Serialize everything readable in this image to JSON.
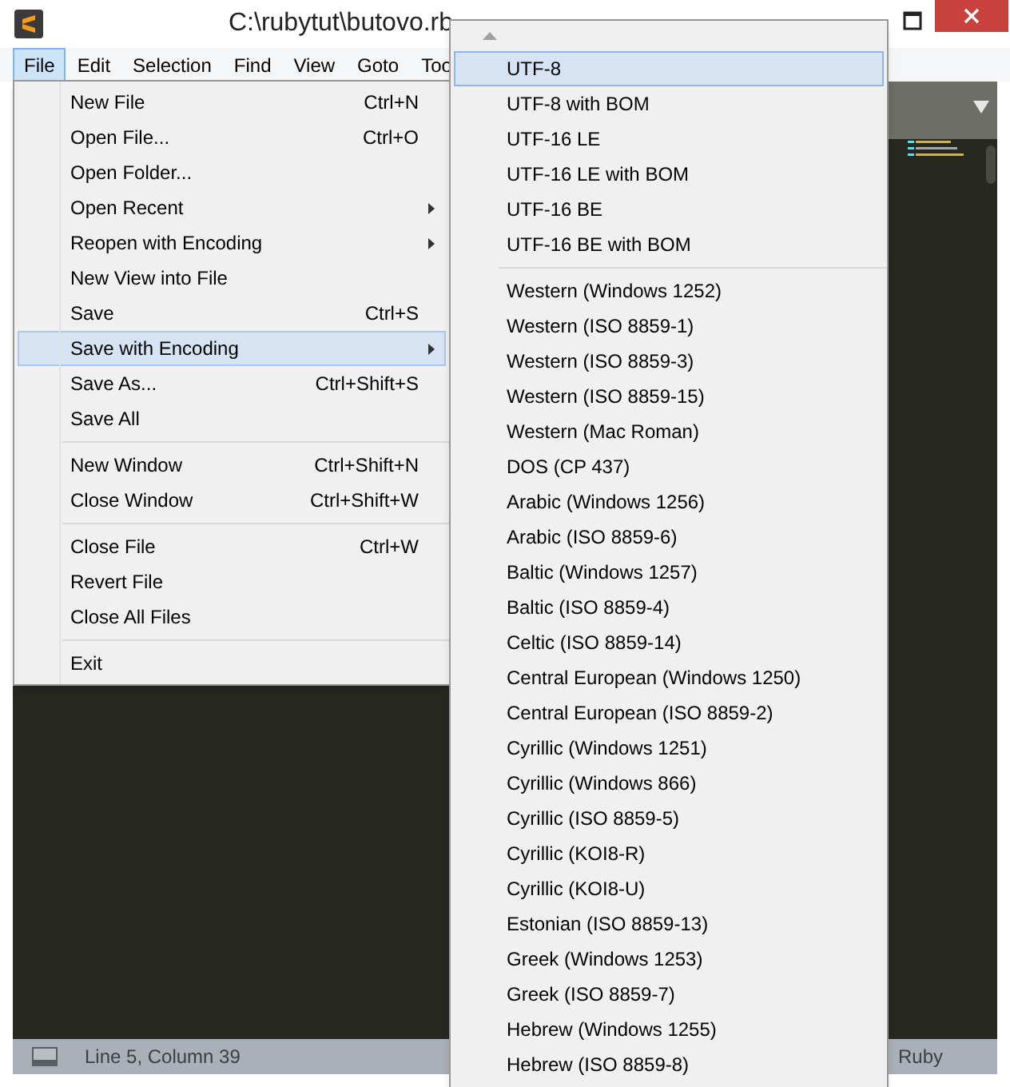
{
  "window": {
    "title": "C:\\rubytut\\butovo.rb"
  },
  "menu_bar": [
    {
      "label": "File",
      "selected": true
    },
    {
      "label": "Edit",
      "selected": false
    },
    {
      "label": "Selection",
      "selected": false
    },
    {
      "label": "Find",
      "selected": false
    },
    {
      "label": "View",
      "selected": false
    },
    {
      "label": "Goto",
      "selected": false
    },
    {
      "label": "Too",
      "selected": false
    }
  ],
  "file_menu": {
    "sections": [
      [
        {
          "label": "New File",
          "shortcut": "Ctrl+N",
          "has_submenu": false,
          "selected": false
        },
        {
          "label": "Open File...",
          "shortcut": "Ctrl+O",
          "has_submenu": false,
          "selected": false
        },
        {
          "label": "Open Folder...",
          "has_submenu": false,
          "selected": false
        },
        {
          "label": "Open Recent",
          "has_submenu": true,
          "selected": false
        },
        {
          "label": "Reopen with Encoding",
          "has_submenu": true,
          "selected": false
        },
        {
          "label": "New View into File",
          "has_submenu": false,
          "selected": false
        },
        {
          "label": "Save",
          "shortcut": "Ctrl+S",
          "has_submenu": false,
          "selected": false
        },
        {
          "label": "Save with Encoding",
          "has_submenu": true,
          "selected": true
        },
        {
          "label": "Save As...",
          "shortcut": "Ctrl+Shift+S",
          "has_submenu": false,
          "selected": false
        },
        {
          "label": "Save All",
          "has_submenu": false,
          "selected": false
        }
      ],
      [
        {
          "label": "New Window",
          "shortcut": "Ctrl+Shift+N",
          "has_submenu": false,
          "selected": false
        },
        {
          "label": "Close Window",
          "shortcut": "Ctrl+Shift+W",
          "has_submenu": false,
          "selected": false
        }
      ],
      [
        {
          "label": "Close File",
          "shortcut": "Ctrl+W",
          "has_submenu": false,
          "selected": false
        },
        {
          "label": "Revert File",
          "has_submenu": false,
          "selected": false
        },
        {
          "label": "Close All Files",
          "has_submenu": false,
          "selected": false
        }
      ],
      [
        {
          "label": "Exit",
          "has_submenu": false,
          "selected": false
        }
      ]
    ]
  },
  "encoding_menu": {
    "sections": [
      [
        {
          "label": "UTF-8",
          "selected": true
        },
        {
          "label": "UTF-8 with BOM",
          "selected": false
        },
        {
          "label": "UTF-16 LE",
          "selected": false
        },
        {
          "label": "UTF-16 LE with BOM",
          "selected": false
        },
        {
          "label": "UTF-16 BE",
          "selected": false
        },
        {
          "label": "UTF-16 BE with BOM",
          "selected": false
        }
      ],
      [
        {
          "label": "Western (Windows 1252)",
          "selected": false
        },
        {
          "label": "Western (ISO 8859-1)",
          "selected": false
        },
        {
          "label": "Western (ISO 8859-3)",
          "selected": false
        },
        {
          "label": "Western (ISO 8859-15)",
          "selected": false
        },
        {
          "label": "Western (Mac Roman)",
          "selected": false
        },
        {
          "label": "DOS (CP 437)",
          "selected": false
        },
        {
          "label": "Arabic (Windows 1256)",
          "selected": false
        },
        {
          "label": "Arabic (ISO 8859-6)",
          "selected": false
        },
        {
          "label": "Baltic (Windows 1257)",
          "selected": false
        },
        {
          "label": "Baltic (ISO 8859-4)",
          "selected": false
        },
        {
          "label": "Celtic (ISO 8859-14)",
          "selected": false
        },
        {
          "label": "Central European (Windows 1250)",
          "selected": false
        },
        {
          "label": "Central European (ISO 8859-2)",
          "selected": false
        },
        {
          "label": "Cyrillic (Windows 1251)",
          "selected": false
        },
        {
          "label": "Cyrillic (Windows 866)",
          "selected": false
        },
        {
          "label": "Cyrillic (ISO 8859-5)",
          "selected": false
        },
        {
          "label": "Cyrillic (KOI8-R)",
          "selected": false
        },
        {
          "label": "Cyrillic (KOI8-U)",
          "selected": false
        },
        {
          "label": "Estonian (ISO 8859-13)",
          "selected": false
        },
        {
          "label": "Greek (Windows 1253)",
          "selected": false
        },
        {
          "label": "Greek (ISO 8859-7)",
          "selected": false
        },
        {
          "label": "Hebrew (Windows 1255)",
          "selected": false
        },
        {
          "label": "Hebrew (ISO 8859-8)",
          "selected": false
        }
      ]
    ]
  },
  "status_bar": {
    "position": "Line 5, Column 39",
    "syntax": "Ruby"
  }
}
